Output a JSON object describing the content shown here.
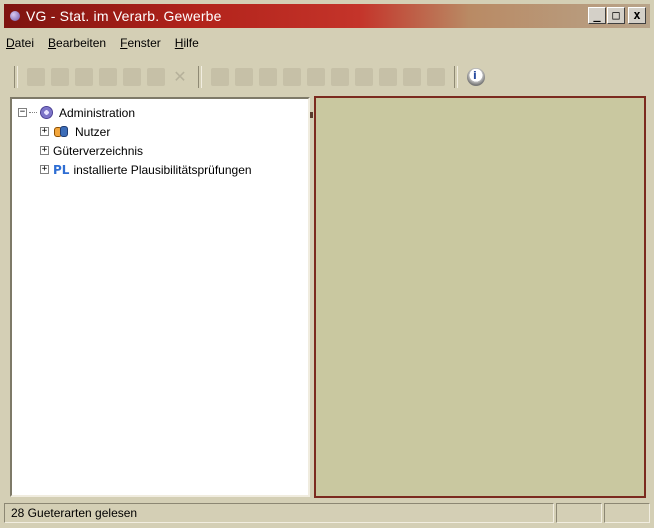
{
  "window": {
    "title": "VG - Stat. im Verarb. Gewerbe",
    "controls": {
      "minimize": "_",
      "maximize": "□",
      "close": "x"
    }
  },
  "menu": [
    {
      "label": "Datei",
      "mnemonic": "D",
      "rest": "atei"
    },
    {
      "label": "Bearbeiten",
      "mnemonic": "B",
      "rest": "earbeiten"
    },
    {
      "label": "Fenster",
      "mnemonic": "F",
      "rest": "enster"
    },
    {
      "label": "Hilfe",
      "mnemonic": "H",
      "rest": "ilfe"
    }
  ],
  "toolbar": {
    "icons": [
      "open-icon",
      "print-icon",
      "back-icon",
      "forward-icon",
      "save-icon",
      "save-all-icon",
      "delete-icon",
      "cut-icon",
      "copy-icon",
      "paste-icon",
      "doc-icon",
      "doc2-icon",
      "record-icon",
      "db-icon",
      "list-icon",
      "table-icon",
      "report-icon",
      "info-icon"
    ]
  },
  "tree": {
    "root": {
      "label": "Administration",
      "expander": "−",
      "icon": "gear-icon"
    },
    "children": [
      {
        "label": "Nutzer",
        "expander": "+",
        "icon": "users-icon"
      },
      {
        "label": "Güterverzeichnis",
        "expander": "+",
        "icon": ""
      },
      {
        "label": "installierte Plausibilitätsprüfungen",
        "expander": "+",
        "icon": "pl-icon",
        "icon_text": "PL"
      }
    ]
  },
  "status": {
    "text": "28 Gueterarten gelesen"
  },
  "colors": {
    "titlebar_start": "#7e1410",
    "titlebar_mid": "#c4342a",
    "window_bg": "#d4cfb5",
    "right_pane_bg": "#c9c8a0",
    "right_pane_border": "#7b2a1f"
  }
}
